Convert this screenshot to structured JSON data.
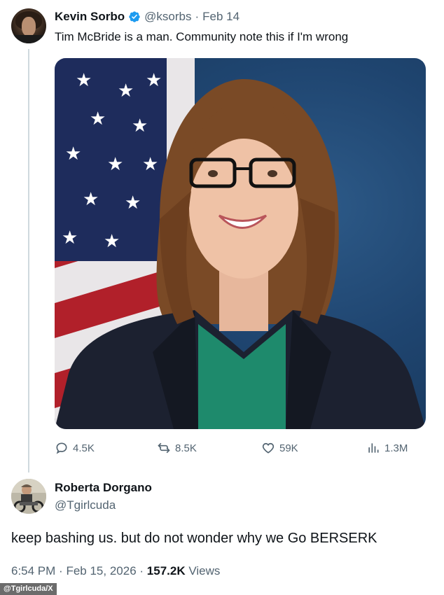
{
  "tweet": {
    "author_name": "Kevin Sorbo",
    "author_handle": "@ksorbs",
    "separator": "·",
    "date": "Feb 14",
    "text": "Tim McBride is a man. Community note this if I'm wrong",
    "verified_icon": "verified-badge-icon",
    "stats": {
      "replies": "4.5K",
      "reposts": "8.5K",
      "likes": "59K",
      "views": "1.3M"
    }
  },
  "reply": {
    "author_name": "Roberta Dorgano",
    "author_handle": "@Tgirlcuda",
    "text": "keep bashing us. but do not wonder why we Go BERSERK",
    "meta": {
      "time": "6:54 PM",
      "separator": "·",
      "date": "Feb 15, 2026",
      "separator2": "·",
      "views_count": "157.2K",
      "views_label": "Views"
    }
  },
  "credit": "@Tgirlcuda/X",
  "colors": {
    "text_primary": "#0f1419",
    "text_secondary": "#536471",
    "verified_blue": "#1d9bf0",
    "thread_line": "#cfd9de"
  }
}
